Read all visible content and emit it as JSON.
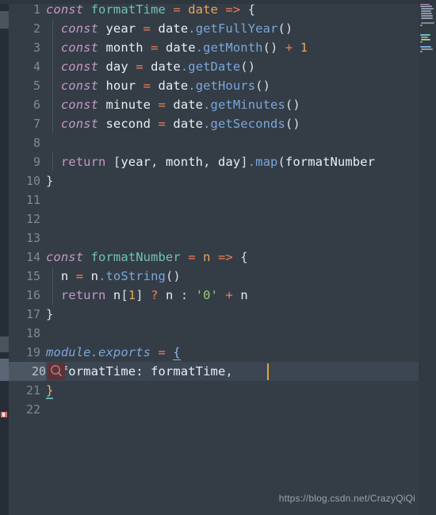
{
  "editor": {
    "theme_name": "dark-oceanic",
    "background_color": "#343d46",
    "gutter_color": "#343d46",
    "active_line_number": 20,
    "active_line_bg": "#4b5663",
    "caret_color": "#e8a33d",
    "total_lines": 22
  },
  "lines": [
    {
      "num": "1",
      "text": "const formatTime = date => {"
    },
    {
      "num": "2",
      "text": "  const year = date.getFullYear()"
    },
    {
      "num": "3",
      "text": "  const month = date.getMonth() + 1"
    },
    {
      "num": "4",
      "text": "  const day = date.getDate()"
    },
    {
      "num": "5",
      "text": "  const hour = date.getHours()"
    },
    {
      "num": "6",
      "text": "  const minute = date.getMinutes()"
    },
    {
      "num": "7",
      "text": "  const second = date.getSeconds()"
    },
    {
      "num": "8",
      "text": ""
    },
    {
      "num": "9",
      "text": "  return [year, month, day].map(formatNumber"
    },
    {
      "num": "10",
      "text": "}"
    },
    {
      "num": "11",
      "text": ""
    },
    {
      "num": "12",
      "text": ""
    },
    {
      "num": "13",
      "text": ""
    },
    {
      "num": "14",
      "text": "const formatNumber = n => {"
    },
    {
      "num": "15",
      "text": "  n = n.toString()"
    },
    {
      "num": "16",
      "text": "  return n[1] ? n : '0' + n"
    },
    {
      "num": "17",
      "text": "}"
    },
    {
      "num": "18",
      "text": ""
    },
    {
      "num": "19",
      "text": "module.exports = {"
    },
    {
      "num": "20",
      "text": "  formatTime: formatTime,"
    },
    {
      "num": "21",
      "text": "}"
    },
    {
      "num": "22",
      "text": ""
    }
  ],
  "line_numbers": [
    "1",
    "2",
    "3",
    "4",
    "5",
    "6",
    "7",
    "8",
    "9",
    "10",
    "11",
    "12",
    "13",
    "14",
    "15",
    "16",
    "17",
    "18",
    "19",
    "20",
    "21",
    "22"
  ],
  "tokens": {
    "keyword_const": "const",
    "keyword_return": "return",
    "fn_formatTime": "formatTime",
    "fn_formatNumber": "formatNumber",
    "param_date": "date",
    "param_n": "n",
    "arrow": "=>",
    "assign": "=",
    "plus": "+",
    "question": "?",
    "colon": ":",
    "open_brace": "{",
    "close_brace": "}",
    "var_year": "year",
    "var_month": "month",
    "var_day": "day",
    "var_hour": "hour",
    "var_minute": "minute",
    "var_second": "second",
    "method_getFullYear": ".getFullYear",
    "method_getMonth": ".getMonth",
    "method_getDate": ".getDate",
    "method_getHours": ".getHours",
    "method_getMinutes": ".getMinutes",
    "method_getSeconds": ".getSeconds",
    "method_map": ".map",
    "method_toString": ".toString",
    "module_exports": "module.exports",
    "string_zero": "'0'",
    "number_one": "1",
    "paren_open": "(",
    "paren_close": ")",
    "bracket_open": "[",
    "bracket_close": "]",
    "comma": ",",
    "key_formatTime": "formatTime:"
  },
  "inspection": {
    "badge_icon": "magnifier-icon",
    "badge_color": "#5a3338",
    "badge_line": 20
  },
  "markers": {
    "error_marker_color": "#d96c6c",
    "overview_mark_color": "#4a545f"
  },
  "watermark": {
    "text": "https://blog.csdn.net/CrazyQiQi"
  },
  "colors": {
    "keyword": "#c596c7",
    "function": "#6fc2b4",
    "operator": "#ef7c5b",
    "parameter": "#eaa45c",
    "property": "#7aa6da",
    "string": "#9acb73",
    "number": "#eaa45c",
    "text": "#d8dee9",
    "line_number": "#7b8999",
    "background": "#343d46",
    "minimap_bg": "#313942"
  }
}
